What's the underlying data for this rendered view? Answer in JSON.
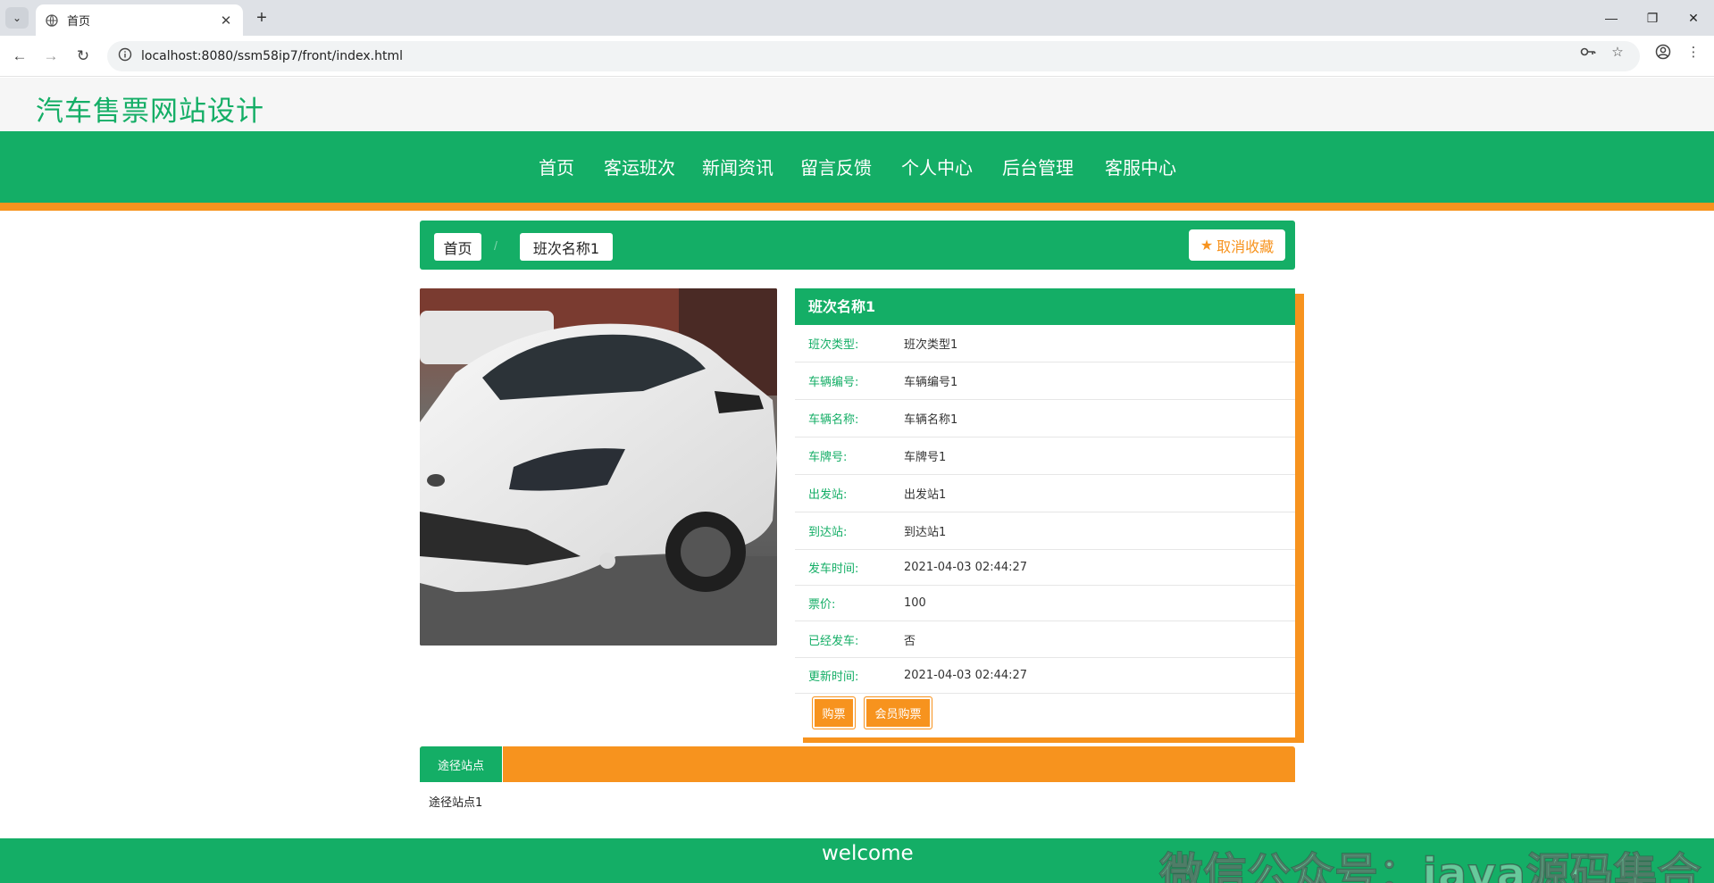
{
  "browser": {
    "tab_title": "首页",
    "url": "localhost:8080/ssm58ip7/front/index.html",
    "icons": [
      "tab-list-icon",
      "globe-icon",
      "close-icon",
      "plus-icon",
      "minimize-icon",
      "restore-icon",
      "close-window-icon",
      "back-icon",
      "forward-icon",
      "reload-icon",
      "site-info-icon",
      "key-icon",
      "bookmark-star-icon",
      "profile-icon",
      "more-icon"
    ]
  },
  "site": {
    "title": "汽车售票网站设计"
  },
  "nav": {
    "items": [
      "首页",
      "客运班次",
      "新闻资讯",
      "留言反馈",
      "个人中心",
      "后台管理",
      "客服中心"
    ]
  },
  "breadcrumb": {
    "home": "首页",
    "separator": "/",
    "current": "班次名称1",
    "favorite_label": "取消收藏"
  },
  "detail": {
    "title": "班次名称1",
    "rows": [
      {
        "label": "班次类型:",
        "value": "班次类型1"
      },
      {
        "label": "车辆编号:",
        "value": "车辆编号1"
      },
      {
        "label": "车辆名称:",
        "value": "车辆名称1"
      },
      {
        "label": "车牌号:",
        "value": "车牌号1"
      },
      {
        "label": "出发站:",
        "value": "出发站1"
      },
      {
        "label": "到达站:",
        "value": "到达站1"
      },
      {
        "label": "发车时间:",
        "value": "2021-04-03 02:44:27"
      },
      {
        "label": "票价:",
        "value": "100"
      },
      {
        "label": "已经发车:",
        "value": "否"
      },
      {
        "label": "更新时间:",
        "value": "2021-04-03 02:44:27"
      }
    ],
    "buy_label": "购票",
    "member_buy_label": "会员购票"
  },
  "tabs": {
    "active": "途径站点",
    "content": "途径站点1"
  },
  "footer": {
    "text": "welcome",
    "watermark": "微信公众号：java源码集合"
  },
  "colors": {
    "primary": "#14ae66",
    "accent": "#f7931e"
  }
}
